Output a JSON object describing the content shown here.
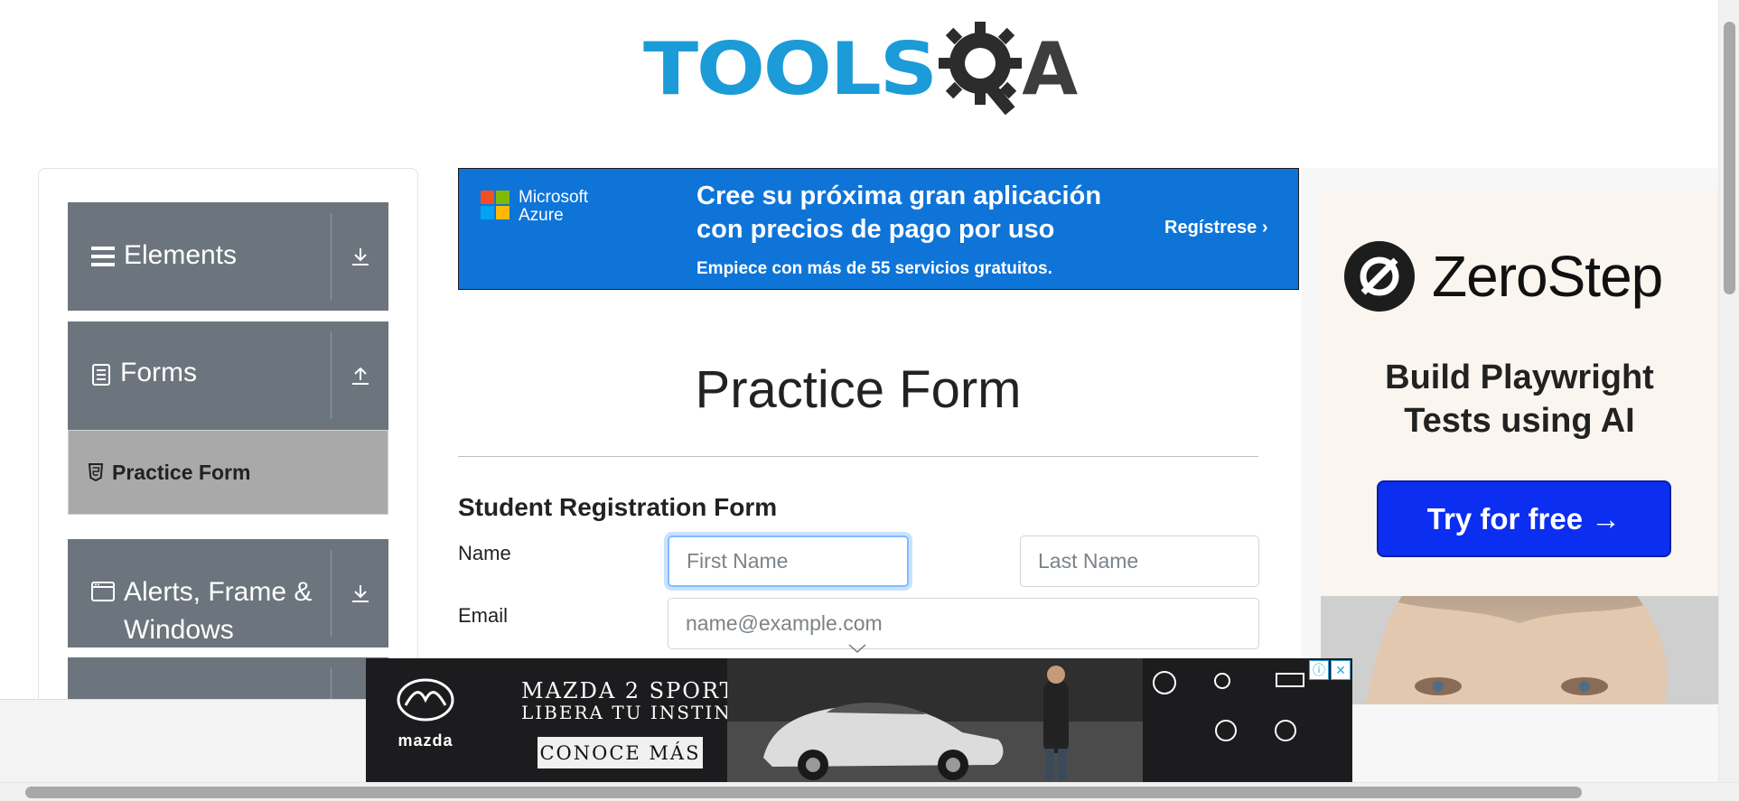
{
  "header": {
    "logo_text": "TOOLS",
    "logo_suffix": "A"
  },
  "sidebar": {
    "groups": [
      {
        "label": "Elements",
        "icon": "hamburger-icon",
        "toggle": "download-icon"
      },
      {
        "label": "Forms",
        "icon": "document-icon",
        "toggle": "upload-icon"
      },
      {
        "label": "Alerts, Frame &",
        "label2": "Windows",
        "icon": "window-icon",
        "toggle": "download-icon"
      }
    ],
    "active_item": {
      "label": "Practice Form",
      "icon": "html5-icon"
    }
  },
  "banner_azure": {
    "brand_line1": "Microsoft",
    "brand_line2": "Azure",
    "headline_line1": "Cree su próxima gran aplicación",
    "headline_line2": "con precios de pago por uso",
    "subtext": "Empiece con más de 55 servicios gratuitos.",
    "cta": "Regístrese ›"
  },
  "main": {
    "title": "Practice Form",
    "form_heading": "Student Registration Form",
    "name_label": "Name",
    "email_label": "Email",
    "first_name_placeholder": "First Name",
    "last_name_placeholder": "Last Name",
    "email_placeholder": "name@example.com"
  },
  "ad_right": {
    "brand": "ZeroStep",
    "tagline_line1": "Build Playwright",
    "tagline_line2": "Tests using AI",
    "cta": "Try for free →"
  },
  "ad_bottom": {
    "brand": "mazda",
    "headline_line1": "MAZDA 2 SPORT",
    "headline_line2": "LIBERA TU INSTINTO",
    "cta": "CONOCE MÁS"
  },
  "colors": {
    "sidebar_group": "#6c757d",
    "sidebar_active": "#a9a9a9",
    "logo_blue": "#1b9bd7",
    "azure_blue": "#0e74d8",
    "zerostep_button": "#0b2ef0"
  }
}
